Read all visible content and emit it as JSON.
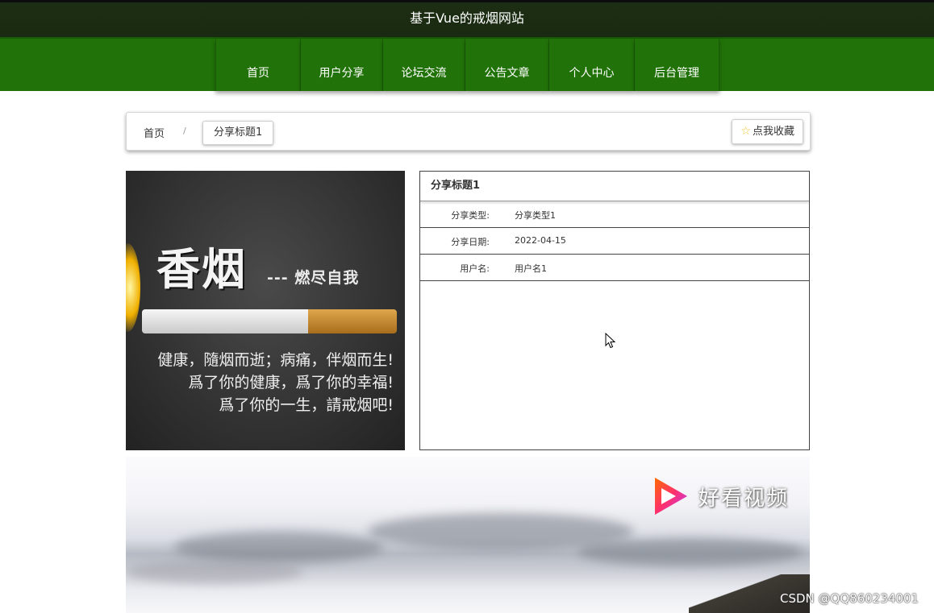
{
  "header": {
    "title": "基于Vue的戒烟网站"
  },
  "nav": {
    "items": [
      {
        "label": "首页"
      },
      {
        "label": "用户分享"
      },
      {
        "label": "论坛交流"
      },
      {
        "label": "公告文章"
      },
      {
        "label": "个人中心"
      },
      {
        "label": "后台管理"
      }
    ]
  },
  "breadcrumb": {
    "home": "首页",
    "separator": "/",
    "current": "分享标题1",
    "favorite_label": "点我收藏",
    "favorite_icon": "star-icon"
  },
  "cover_image": {
    "headline": "香烟",
    "subheadline": "--- 燃尽自我",
    "lines": [
      "健康，隨烟而逝；病痛，伴烟而生!",
      "爲了你的健康，爲了你的幸福!",
      "爲了你的一生，請戒烟吧!"
    ]
  },
  "detail": {
    "title": "分享标题1",
    "rows": [
      {
        "label": "分享类型:",
        "value": "分享类型1"
      },
      {
        "label": "分享日期:",
        "value": "2022-04-15"
      },
      {
        "label": "用户名:",
        "value": "用户名1"
      }
    ]
  },
  "video": {
    "logo_text": "好看视频"
  },
  "watermark": "CSDN @QQ860234001",
  "colors": {
    "header_bg": "#1a2a12",
    "nav_bg": "#217309",
    "star": "#f2c230"
  }
}
